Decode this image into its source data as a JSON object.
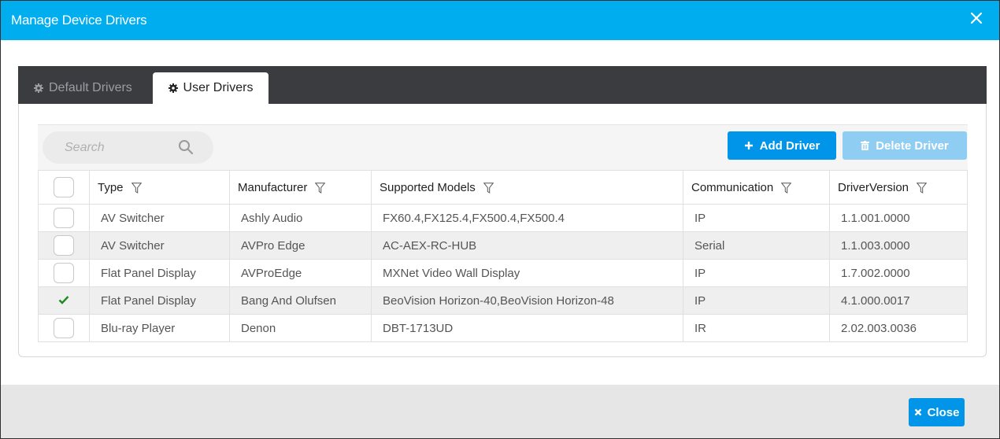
{
  "dialog": {
    "title": "Manage Device Drivers"
  },
  "tabs": [
    {
      "label": "Default Drivers",
      "active": false
    },
    {
      "label": "User Drivers",
      "active": true
    }
  ],
  "search": {
    "placeholder": "Search"
  },
  "toolbar": {
    "add_label": "Add Driver",
    "delete_label": "Delete Driver"
  },
  "table": {
    "columns": [
      "Type",
      "Manufacturer",
      "Supported Models",
      "Communication",
      "DriverVersion"
    ],
    "rows": [
      {
        "checked": false,
        "type": "AV Switcher",
        "manufacturer": "Ashly Audio",
        "models": "FX60.4,FX125.4,FX500.4,FX500.4",
        "communication": "IP",
        "version": "1.1.001.0000"
      },
      {
        "checked": false,
        "type": "AV Switcher",
        "manufacturer": "AVPro Edge",
        "models": "AC-AEX-RC-HUB",
        "communication": "Serial",
        "version": "1.1.003.0000"
      },
      {
        "checked": false,
        "type": "Flat Panel Display",
        "manufacturer": "AVProEdge",
        "models": "MXNet Video Wall Display",
        "communication": "IP",
        "version": "1.7.002.0000"
      },
      {
        "checked": true,
        "type": "Flat Panel Display",
        "manufacturer": "Bang And Olufsen",
        "models": "BeoVision Horizon-40,BeoVision Horizon-48",
        "communication": "IP",
        "version": "4.1.000.0017"
      },
      {
        "checked": false,
        "type": "Blu-ray Player",
        "manufacturer": "Denon",
        "models": "DBT-1713UD",
        "communication": "IR",
        "version": "2.02.003.0036"
      }
    ]
  },
  "footer": {
    "close_label": "Close"
  },
  "colors": {
    "titlebar": "#00aef0",
    "primary_button": "#0095e8",
    "disabled_button": "#8fcdf3",
    "tabstrip": "#3a3c40"
  }
}
